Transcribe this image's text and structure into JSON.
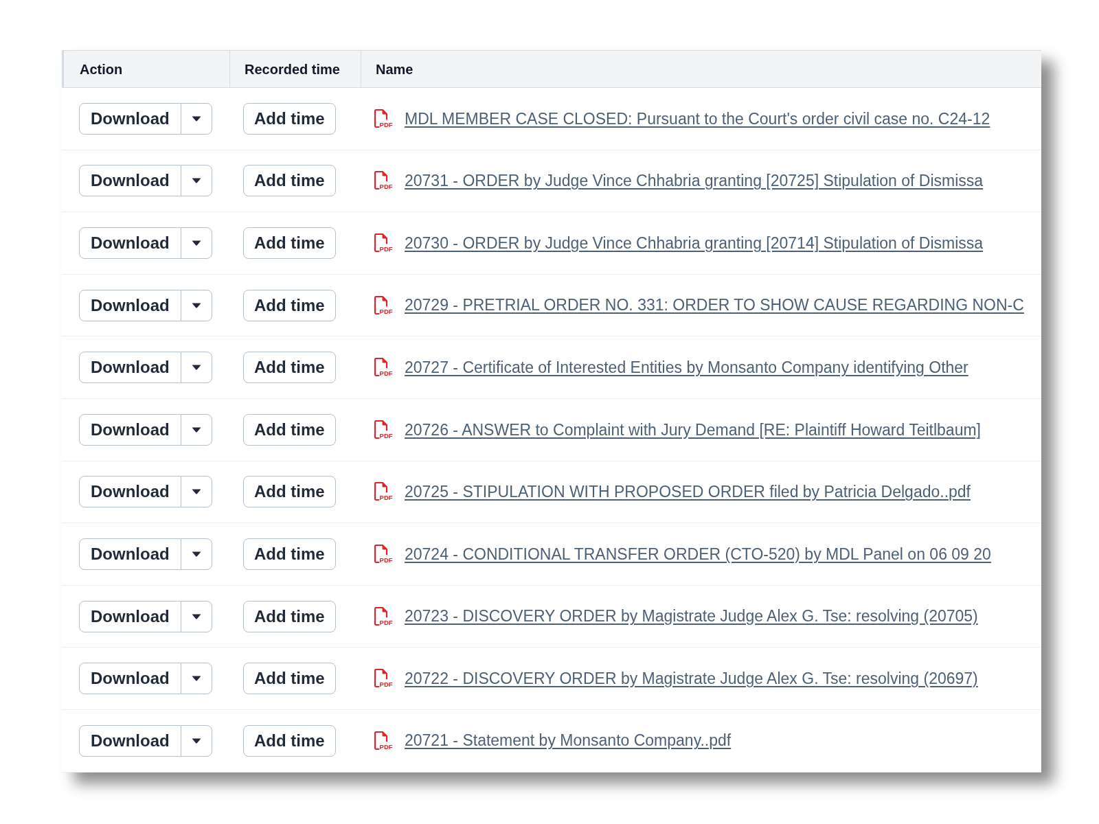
{
  "table": {
    "columns": [
      "Action",
      "Recorded time",
      "Name"
    ],
    "rows": [
      {
        "download_button": "Download",
        "add_time_button": "Add time",
        "file_badge": "PDF",
        "name": "MDL MEMBER CASE CLOSED: Pursuant to the Court's order civil case no. C24-12"
      },
      {
        "download_button": "Download",
        "add_time_button": "Add time",
        "file_badge": "PDF",
        "name": "20731 - ORDER by Judge Vince Chhabria granting [20725] Stipulation of Dismissa"
      },
      {
        "download_button": "Download",
        "add_time_button": "Add time",
        "file_badge": "PDF",
        "name": "20730 - ORDER by Judge Vince Chhabria granting [20714] Stipulation of Dismissa"
      },
      {
        "download_button": "Download",
        "add_time_button": "Add time",
        "file_badge": "PDF",
        "name": "20729 - PRETRIAL ORDER NO. 331: ORDER TO SHOW CAUSE REGARDING NON-C"
      },
      {
        "download_button": "Download",
        "add_time_button": "Add time",
        "file_badge": "PDF",
        "name": "20727 - Certificate of Interested Entities by Monsanto Company identifying Other"
      },
      {
        "download_button": "Download",
        "add_time_button": "Add time",
        "file_badge": "PDF",
        "name": "20726 - ANSWER to Complaint with Jury Demand [RE: Plaintiff Howard Teitlbaum]"
      },
      {
        "download_button": "Download",
        "add_time_button": "Add time",
        "file_badge": "PDF",
        "name": "20725 - STIPULATION WITH PROPOSED ORDER filed by Patricia Delgado..pdf"
      },
      {
        "download_button": "Download",
        "add_time_button": "Add time",
        "file_badge": "PDF",
        "name": "20724 - CONDITIONAL TRANSFER ORDER (CTO-520) by MDL Panel on 06 09 20"
      },
      {
        "download_button": "Download",
        "add_time_button": "Add time",
        "file_badge": "PDF",
        "name": "20723 - DISCOVERY ORDER by Magistrate Judge Alex G. Tse: resolving (20705)"
      },
      {
        "download_button": "Download",
        "add_time_button": "Add time",
        "file_badge": "PDF",
        "name": "20722 - DISCOVERY ORDER by Magistrate Judge Alex G. Tse: resolving (20697)"
      },
      {
        "download_button": "Download",
        "add_time_button": "Add time",
        "file_badge": "PDF",
        "name": "20721 - Statement by Monsanto Company..pdf"
      }
    ]
  }
}
